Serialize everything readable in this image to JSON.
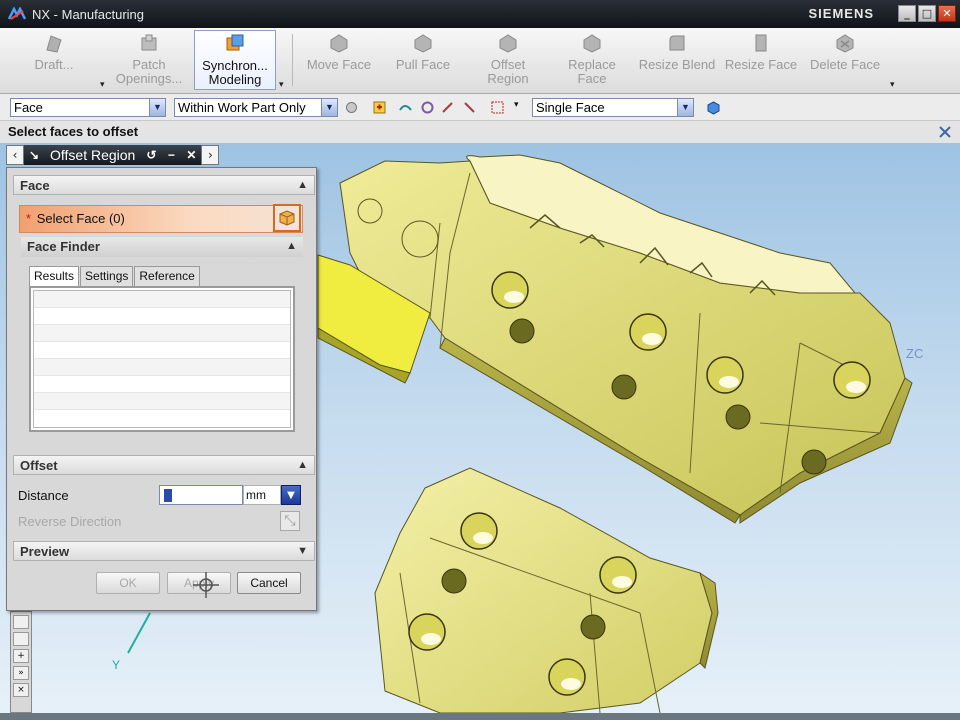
{
  "window": {
    "title": "NX - Manufacturing",
    "brand": "SIEMENS",
    "buttons": [
      "_",
      "□",
      "✕"
    ]
  },
  "ribbon": {
    "items": [
      {
        "label": "Draft...",
        "icon": "draft-icon",
        "enabled": false
      },
      {
        "label": "Patch Openings...",
        "icon": "patch-icon",
        "enabled": false
      },
      {
        "label": "Synchron... Modeling",
        "icon": "synchronous-modeling-icon",
        "enabled": true
      },
      {
        "label": "Move Face",
        "icon": "move-face-icon",
        "enabled": false
      },
      {
        "label": "Pull Face",
        "icon": "pull-face-icon",
        "enabled": false
      },
      {
        "label": "Offset Region",
        "icon": "offset-region-icon",
        "enabled": false
      },
      {
        "label": "Replace Face",
        "icon": "replace-face-icon",
        "enabled": false
      },
      {
        "label": "Resize Blend",
        "icon": "resize-blend-icon",
        "enabled": false
      },
      {
        "label": "Resize Face",
        "icon": "resize-face-icon",
        "enabled": false
      },
      {
        "label": "Delete Face",
        "icon": "delete-face-icon",
        "enabled": false
      }
    ]
  },
  "selection_bar": {
    "type_filter": "Face",
    "scope": "Within Work Part Only",
    "face_rule": "Single Face"
  },
  "cue_line": "Select faces to offset",
  "dialog": {
    "title": "Offset Region",
    "face_group": {
      "heading": "Face",
      "select_label": "Select Face (0)",
      "required_marker": "*"
    },
    "face_finder": {
      "heading": "Face Finder",
      "tabs": [
        "Results",
        "Settings",
        "Reference"
      ],
      "active_tab": "Results",
      "rows": []
    },
    "offset_group": {
      "heading": "Offset",
      "distance_label": "Distance",
      "distance_value": "0",
      "unit": "mm",
      "reverse_label": "Reverse Direction"
    },
    "preview_heading": "Preview",
    "buttons": {
      "ok": "OK",
      "apply": "Apply",
      "cancel": "Cancel"
    }
  },
  "viewport": {
    "axis_labels": [
      "ZC",
      "Y"
    ],
    "part_color": "#e2de7a",
    "background_top": "#9ec3e3",
    "background_bottom": "#e6f0f8"
  }
}
